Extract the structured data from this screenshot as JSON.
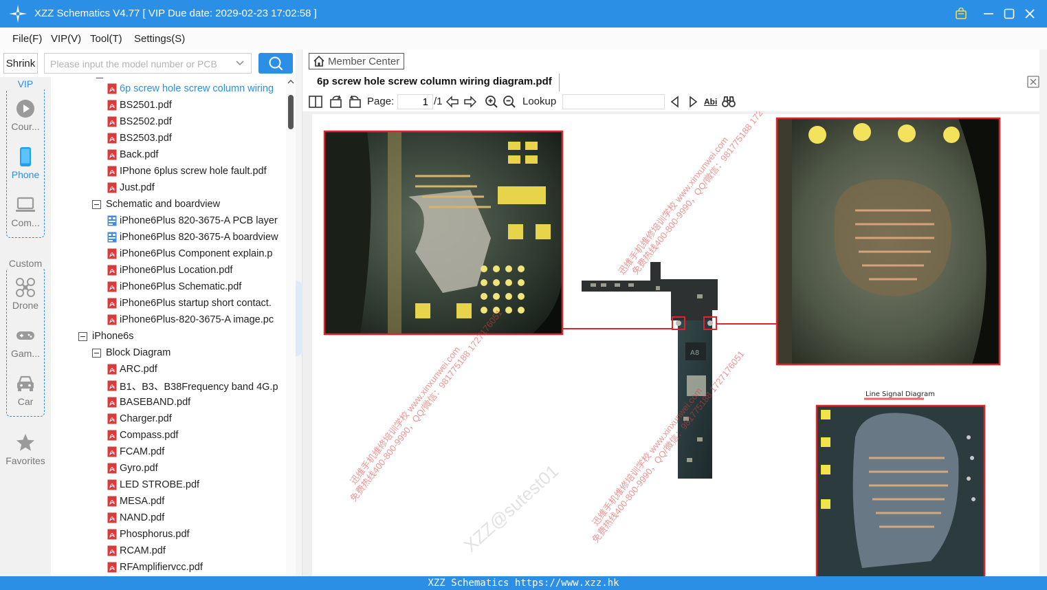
{
  "window": {
    "title": "XZZ Schematics V4.77 [ VIP Due date: 2029-02-23 17:02:58 ]"
  },
  "menu": {
    "items": [
      {
        "label": "File(F)"
      },
      {
        "label": "VIP(V)"
      },
      {
        "label": "Tool(T)"
      },
      {
        "label": "Settings(S)"
      }
    ]
  },
  "search": {
    "shrink_label": "Shrink",
    "placeholder": "Please input the model number or PCB"
  },
  "categories": {
    "vip_label": "VIP",
    "custom_label": "Custom",
    "items": [
      {
        "label": "Cour...",
        "icon": "play-icon"
      },
      {
        "label": "Phone",
        "icon": "phone-icon",
        "active": true
      },
      {
        "label": "Com...",
        "icon": "laptop-icon"
      },
      {
        "label": "Drone",
        "icon": "drone-icon"
      },
      {
        "label": "Gam...",
        "icon": "gamepad-icon"
      },
      {
        "label": "Car",
        "icon": "car-icon"
      }
    ],
    "favorites_label": "Favorites"
  },
  "tree": {
    "rows": [
      {
        "type": "pdf",
        "label": "6p screw hole screw column wiring",
        "level": 2,
        "highlighted": true
      },
      {
        "type": "pdf",
        "label": "BS2501.pdf",
        "level": 2
      },
      {
        "type": "pdf",
        "label": "BS2502.pdf",
        "level": 2
      },
      {
        "type": "pdf",
        "label": "BS2503.pdf",
        "level": 2
      },
      {
        "type": "pdf",
        "label": "Back.pdf",
        "level": 2
      },
      {
        "type": "pdf",
        "label": "IPhone 6plus screw hole fault.pdf",
        "level": 2
      },
      {
        "type": "pdf",
        "label": "Just.pdf",
        "level": 2
      },
      {
        "type": "folder",
        "label": "Schematic and boardview",
        "level": 1
      },
      {
        "type": "boardview",
        "label": "iPhone6Plus 820-3675-A PCB layer",
        "level": 2
      },
      {
        "type": "boardview",
        "label": "iPhone6Plus 820-3675-A boardview",
        "level": 2
      },
      {
        "type": "pdf",
        "label": "iPhone6Plus Component explain.p",
        "level": 2
      },
      {
        "type": "pdf",
        "label": "iPhone6Plus Location.pdf",
        "level": 2
      },
      {
        "type": "pdf",
        "label": "iPhone6Plus Schematic.pdf",
        "level": 2
      },
      {
        "type": "pdf",
        "label": "iPhone6Plus startup short contact.",
        "level": 2
      },
      {
        "type": "pdf",
        "label": "iPhone6Plus-820-3675-A image.pc",
        "level": 2
      },
      {
        "type": "folder",
        "label": "iPhone6s",
        "level": 0
      },
      {
        "type": "folder",
        "label": "Block Diagram",
        "level": 1
      },
      {
        "type": "pdf",
        "label": "ARC.pdf",
        "level": 2
      },
      {
        "type": "pdf",
        "label": "B1、B3、B38Frequency band 4G.p",
        "level": 2
      },
      {
        "type": "pdf",
        "label": "BASEBAND.pdf",
        "level": 2
      },
      {
        "type": "pdf",
        "label": "Charger.pdf",
        "level": 2
      },
      {
        "type": "pdf",
        "label": "Compass.pdf",
        "level": 2
      },
      {
        "type": "pdf",
        "label": "FCAM.pdf",
        "level": 2
      },
      {
        "type": "pdf",
        "label": "Gyro.pdf",
        "level": 2
      },
      {
        "type": "pdf",
        "label": "LED STROBE.pdf",
        "level": 2
      },
      {
        "type": "pdf",
        "label": "MESA.pdf",
        "level": 2
      },
      {
        "type": "pdf",
        "label": "NAND.pdf",
        "level": 2
      },
      {
        "type": "pdf",
        "label": "Phosphorus.pdf",
        "level": 2
      },
      {
        "type": "pdf",
        "label": "RCAM.pdf",
        "level": 2
      },
      {
        "type": "pdf",
        "label": "RFAmplifiervcc.pdf",
        "level": 2
      }
    ]
  },
  "viewer": {
    "member_center_label": "Member Center",
    "doc_tab_title": "6p screw hole screw column wiring diagram.pdf",
    "page_label": "Page:",
    "page_value": "1",
    "page_total": "/1",
    "lookup_label": "Lookup",
    "abi_label": "Abi",
    "diagram_caption": "Line Signal Diagram",
    "watermark_user": "XZZ@sutest01",
    "watermark_school": "迅维手机维修培训学校 www.xinxunwei.com",
    "watermark_phone": "免费热线400-800-9990，QQ/微信：981775188 1727176051",
    "chip_label": "A8"
  },
  "status": {
    "text": "XZZ Schematics https://www.xzz.hk"
  },
  "colors": {
    "accent": "#2b8fe6",
    "pdf_red": "#d93b3b",
    "highlight_red": "#e0242b"
  }
}
